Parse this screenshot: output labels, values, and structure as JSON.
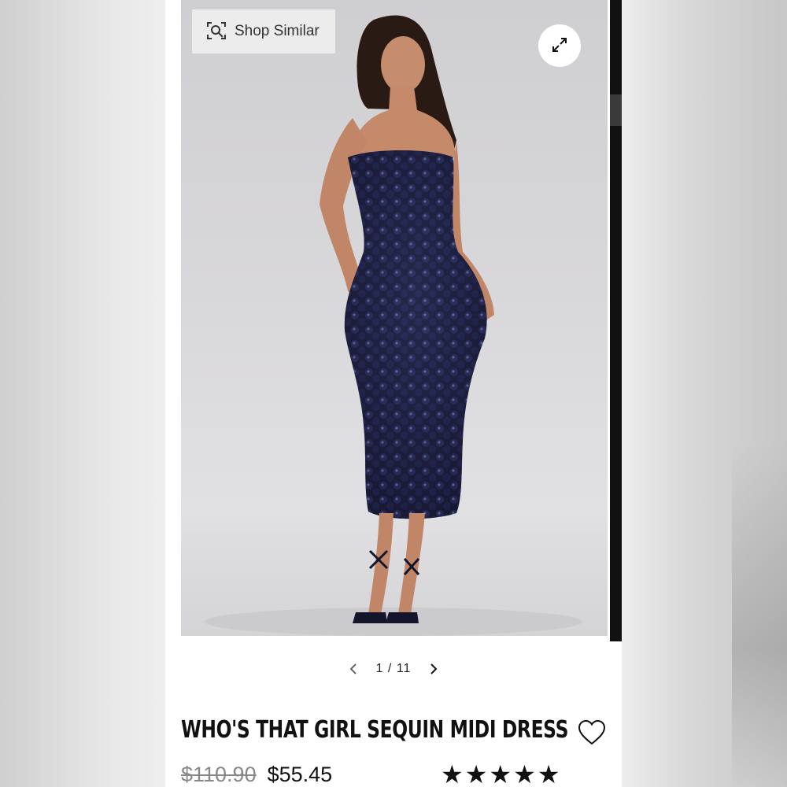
{
  "product": {
    "title": "WHO'S THAT GIRL SEQUIN MIDI DRESS",
    "original_price": "$110.90",
    "sale_price": "$55.45",
    "rating": 5,
    "rating_max": 5
  },
  "gallery": {
    "shop_similar_label": "Shop Similar",
    "current_index": "1",
    "separator": "/",
    "total": "11"
  },
  "colors": {
    "dress": "#1d1f3d",
    "background": "#d6d5d8",
    "text": "#111111",
    "strike": "#888888"
  },
  "icons": {
    "shop_similar": "image-search-icon",
    "expand": "expand-icon",
    "prev": "chevron-left-icon",
    "next": "chevron-right-icon",
    "wishlist": "heart-outline-icon",
    "star": "star-filled-icon"
  }
}
